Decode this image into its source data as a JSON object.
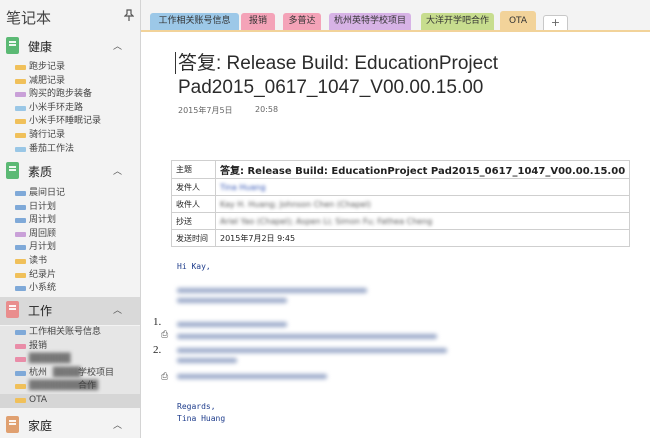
{
  "sidebar": {
    "title": "笔记本",
    "pin_icon": "pin-icon",
    "sections": [
      {
        "label": "健康",
        "color": "#5bb974",
        "pages": [
          {
            "label": "跑步记录",
            "color": "#f0c05a"
          },
          {
            "label": "减肥记录",
            "color": "#f0c05a"
          },
          {
            "label": "购买的跑步装备",
            "color": "#c9a0d8"
          },
          {
            "label": "小米手环走路",
            "color": "#9ac7e6"
          },
          {
            "label": "小米手环睡眠记录",
            "color": "#f0c05a"
          },
          {
            "label": "骑行记录",
            "color": "#f0c05a"
          },
          {
            "label": "番茄工作法",
            "color": "#9ac7e6"
          }
        ]
      },
      {
        "label": "素质",
        "color": "#5bb974",
        "pages": [
          {
            "label": "晨间日记",
            "color": "#7fa9d8"
          },
          {
            "label": "日计划",
            "color": "#7fa9d8"
          },
          {
            "label": "周计划",
            "color": "#7fa9d8"
          },
          {
            "label": "周回顾",
            "color": "#c9a0d8"
          },
          {
            "label": "月计划",
            "color": "#7fa9d8"
          },
          {
            "label": "读书",
            "color": "#f0c05a"
          },
          {
            "label": "纪录片",
            "color": "#f0c05a"
          },
          {
            "label": "小系统",
            "color": "#7fa9d8"
          }
        ]
      },
      {
        "label": "工作",
        "color": "#e98d8d",
        "pages": [
          {
            "label": "工作相关账号信息",
            "color": "#7fa9d8"
          },
          {
            "label": "报销",
            "color": "#e98da8"
          },
          {
            "label": "",
            "color": "#e98da8"
          },
          {
            "label": "杭州",
            "suffix": "学校项目",
            "color": "#7fa9d8"
          },
          {
            "label": "",
            "suffix": "合作",
            "color": "#f0c05a"
          },
          {
            "label": "OTA",
            "color": "#f0c05a",
            "selected": true
          }
        ]
      },
      {
        "label": "家庭",
        "color": "#e0a070",
        "pages": []
      }
    ]
  },
  "tabs": [
    {
      "label": "工作相关账号信息",
      "color": "#9cc8e8"
    },
    {
      "label": "报销",
      "color": "#f4a3b8"
    },
    {
      "label": "多普达",
      "color": "#f4a3b8"
    },
    {
      "label": "杭州英特学校项目",
      "color": "#d7b3e6"
    },
    {
      "label": "大洋开学吧合作",
      "color": "#c7dd8e"
    },
    {
      "label": "OTA",
      "color": "#f2d39a",
      "active": true
    }
  ],
  "add_tab_label": "+",
  "page": {
    "title": "答复: Release Build: EducationProject Pad2015_0617_1047_V00.00.15.00",
    "date": "2015年7月5日",
    "time": "20:58"
  },
  "email": {
    "subject_label": "主题",
    "subject": "答复: Release Build: EducationProject Pad2015_0617_1047_V00.00.15.00",
    "from_label": "发件人",
    "from": "Tina Huang",
    "to_label": "收件人",
    "to": "Kay H. Huang; Johnson Chen (Chapel)",
    "cc_label": "抄送",
    "cc": "Ariel Yao (Chapel); Aspen Li; Simon Fu; Fathea Cheng",
    "sent_label": "发送时间",
    "sent": "2015年7月2日 9:45",
    "greeting": "Hi Kay,",
    "list_numbers": [
      "1.",
      "2."
    ],
    "closing": "Regards,",
    "signature": "Tina Huang"
  }
}
